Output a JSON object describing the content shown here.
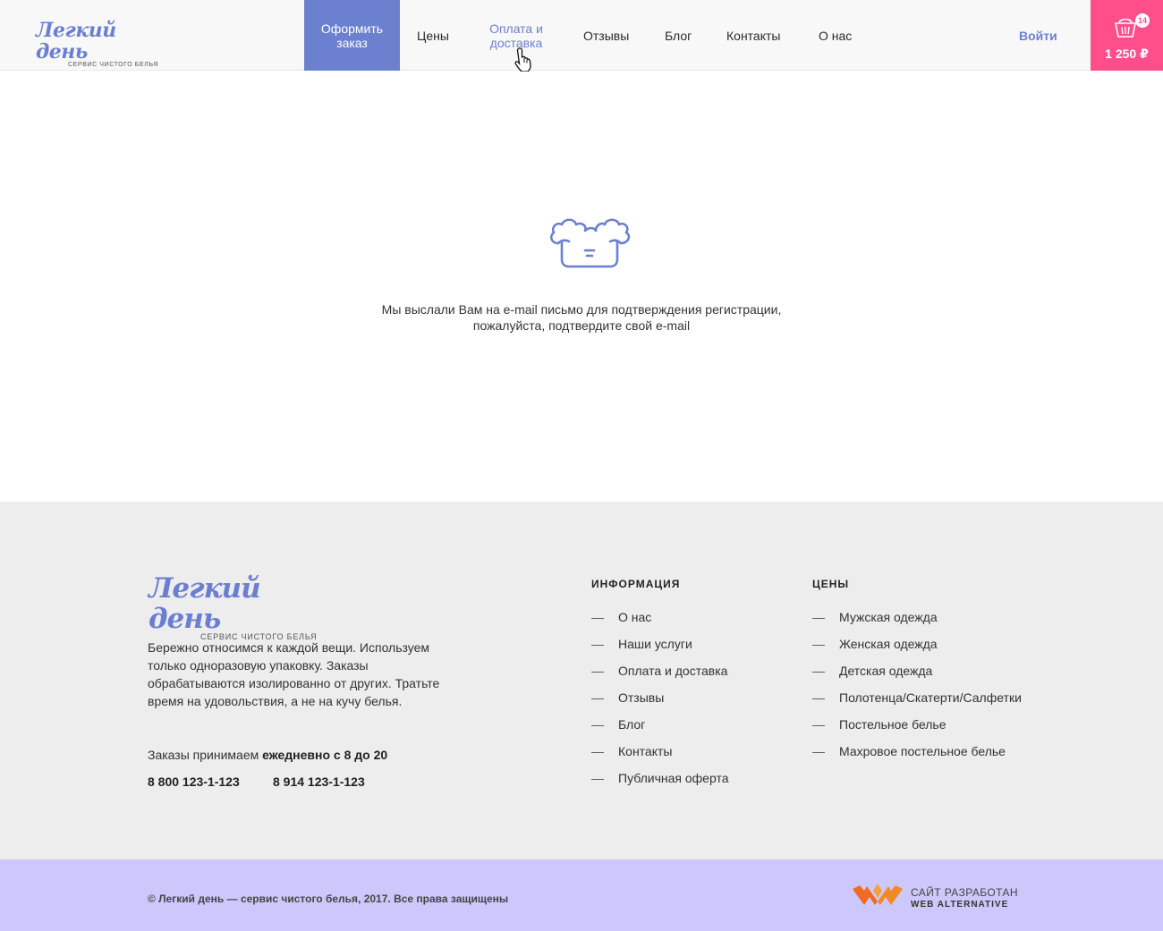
{
  "header": {
    "logo_title": "Легкий день",
    "logo_sub": "сервис чистого белья",
    "nav": {
      "order": "Оформить заказ",
      "prices": "Цены",
      "payment": "Оплата и доставка",
      "reviews": "Отзывы",
      "blog": "Блог",
      "contacts": "Контакты",
      "about": "О нас"
    },
    "login": "Войти",
    "cart": {
      "count": "14",
      "total": "1 250 ₽"
    }
  },
  "main": {
    "message_line1": "Мы выслали Вам на e-mail письмо для подтверждения регистрации,",
    "message_line2": "пожалуйста, подтвердите свой e-mail"
  },
  "footer": {
    "logo_title": "Легкий день",
    "logo_sub": "сервис чистого белья",
    "description": "Бережно относимся к каждой вещи. Используем только одноразовую упаковку.  Заказы обрабатываются изолированно от других. Тратьте время на удовольствия, а не на кучу белья.",
    "hours_prefix": "Заказы  принимаем ",
    "hours_bold": "ежедневно с 8 до 20",
    "phone1": "8 800 123-1-123",
    "phone2": "8 914  123-1-123",
    "info": {
      "title": "ИНФОРМАЦИЯ",
      "items": [
        "О нас",
        "Наши услуги",
        "Оплата и доставка",
        "Отзывы",
        "Блог",
        "Контакты",
        "Публичная оферта"
      ]
    },
    "prices": {
      "title": "ЦЕНЫ",
      "items": [
        "Мужская одежда",
        "Женская одежда",
        "Детская одежда",
        "Полотенца/Скатерти/Салфетки",
        "Постельное белье",
        "Махровое постельное белье"
      ]
    }
  },
  "bottom": {
    "copyright": "© Легкий день — сервис чистого белья, 2017. Все права защищены",
    "dev_line1": "САЙТ РАЗРАБОТАН",
    "dev_line2": "WEB ALTERNATIVE"
  },
  "colors": {
    "accent": "#6b80cf",
    "cart": "#ff4f8b",
    "footer_bg": "#ededed",
    "bottom_bg": "#cdc8fb"
  }
}
